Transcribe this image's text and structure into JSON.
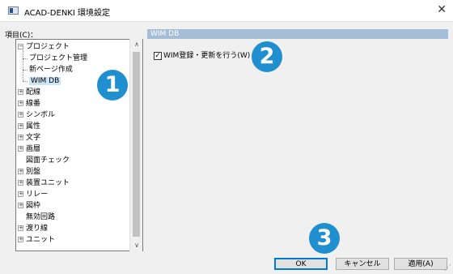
{
  "window": {
    "title": "ACAD-DENKI 環境設定",
    "close_glyph": "✕"
  },
  "tree": {
    "label": "項目(C)：",
    "items": [
      {
        "label": "プロジェクト",
        "expander": "−"
      },
      {
        "label": "プロジェクト管理"
      },
      {
        "label": "新ページ作成"
      },
      {
        "label": "WIM DB",
        "selected": true
      },
      {
        "label": "配線",
        "expander": "+"
      },
      {
        "label": "線番",
        "expander": "+"
      },
      {
        "label": "シンボル",
        "expander": "+"
      },
      {
        "label": "属性",
        "expander": "+"
      },
      {
        "label": "文字",
        "expander": "+"
      },
      {
        "label": "画層",
        "expander": "+"
      },
      {
        "label": "図面チェック"
      },
      {
        "label": "別盤",
        "expander": "+"
      },
      {
        "label": "装置ユニット",
        "expander": "+"
      },
      {
        "label": "リレー",
        "expander": "+"
      },
      {
        "label": "図枠",
        "expander": "+"
      },
      {
        "label": "無効回路"
      },
      {
        "label": "渡り線",
        "expander": "+"
      },
      {
        "label": "ユニット",
        "expander": "+"
      }
    ],
    "scroll_up": "∧",
    "scroll_down": "∨"
  },
  "panel": {
    "header": "WIM DB",
    "checkbox_label": "WIM登録・更新を行う(W)",
    "checkbox_checked": true,
    "check_glyph": "✓"
  },
  "badges": {
    "b1": "1",
    "b2": "2",
    "b3": "3",
    "color": "#1f8fcf"
  },
  "buttons": {
    "ok": "OK",
    "cancel": "キャンセル",
    "apply": "適用(A)"
  },
  "grip_glyph": "⋰"
}
